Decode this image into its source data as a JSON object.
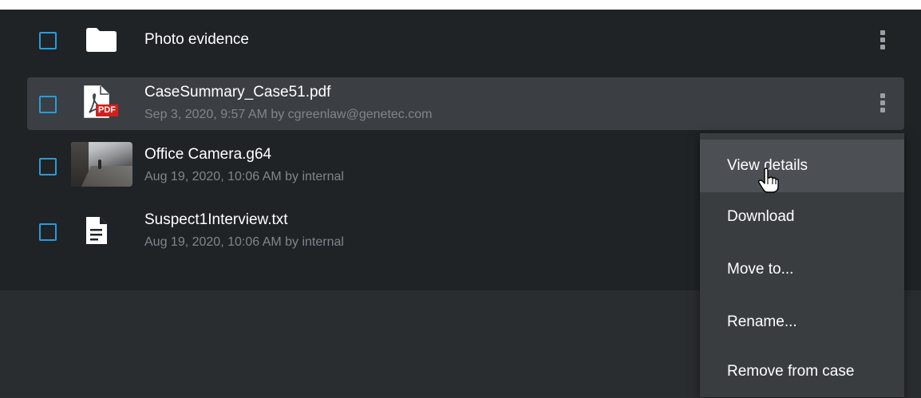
{
  "files": [
    {
      "kind": "folder",
      "name": "Photo evidence",
      "meta": "",
      "icon": "folder-icon",
      "selected": false
    },
    {
      "kind": "pdf",
      "name": "CaseSummary_Case51.pdf",
      "meta": "Sep 3, 2020, 9:57 AM by cgreenlaw@genetec.com",
      "icon": "pdf-file-icon",
      "badge": "PDF",
      "selected": false
    },
    {
      "kind": "video",
      "name": "Office Camera.g64",
      "meta": "Aug 19, 2020, 10:06 AM by internal",
      "icon": "video-thumbnail",
      "selected": false
    },
    {
      "kind": "text",
      "name": "Suspect1Interview.txt",
      "meta": "Aug 19, 2020, 10:06 AM by internal",
      "icon": "text-file-icon",
      "selected": false
    }
  ],
  "context_menu": {
    "items": [
      {
        "label": "View details"
      },
      {
        "label": "Download"
      },
      {
        "label": "Move to..."
      },
      {
        "label": "Rename..."
      },
      {
        "label": "Remove from case"
      }
    ],
    "hovered_item": "View details"
  },
  "colors": {
    "accent": "#2d9ad6",
    "panel_background": "#1f2326",
    "row_highlight": "#3b3f43",
    "menu_background": "#3a3d40",
    "menu_hover": "#4c5054",
    "text_primary": "#ffffff",
    "text_secondary": "#7f868c",
    "pdf_badge": "#d0201f"
  },
  "icons": {
    "more_actions": "more-vert-icon",
    "cursor": "hand-pointer-cursor"
  }
}
